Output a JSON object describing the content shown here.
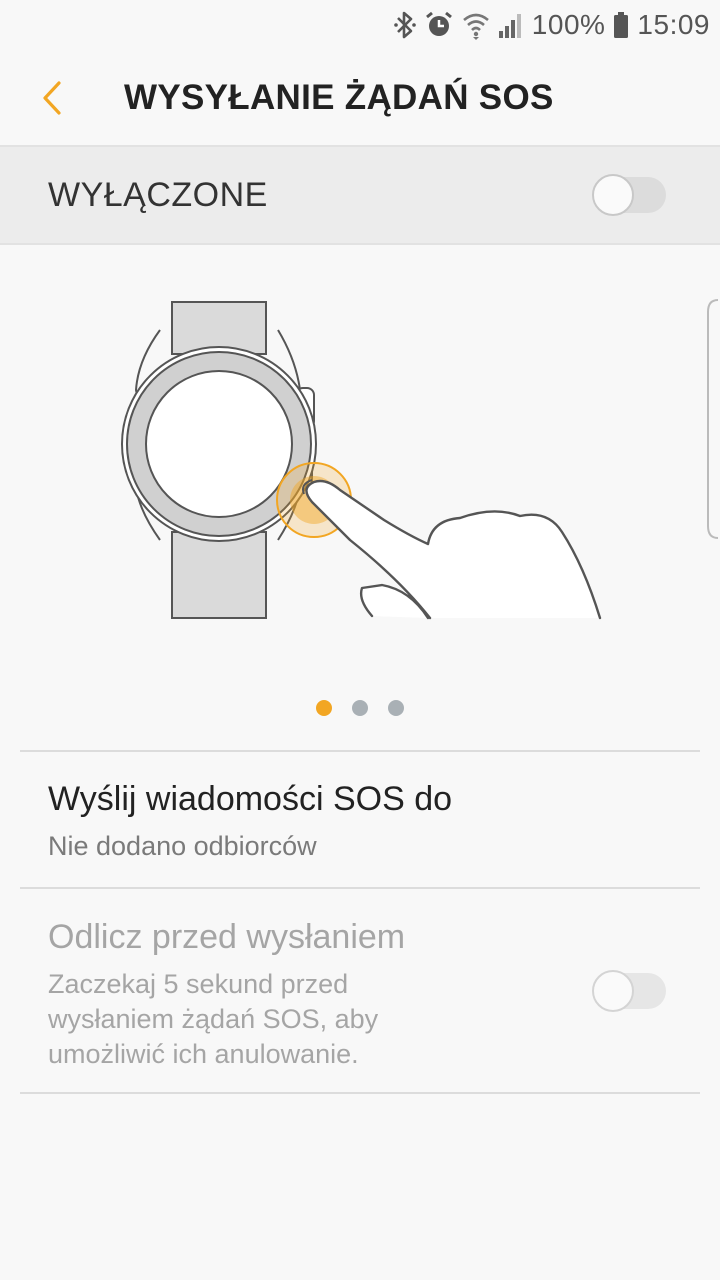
{
  "status_bar": {
    "battery": "100%",
    "time": "15:09",
    "icons": [
      "bluetooth-icon",
      "alarm-icon",
      "wifi-icon",
      "signal-icon",
      "battery-icon"
    ]
  },
  "header": {
    "title": "WYSYŁANIE ŻĄDAŃ SOS",
    "back_icon": "chevron-left-icon",
    "accent": "#f2a623"
  },
  "master_switch": {
    "label": "WYŁĄCZONE",
    "state": "off"
  },
  "carousel": {
    "pages": 3,
    "active_page": 1,
    "illustration": "watch-button-press"
  },
  "settings": [
    {
      "title": "Wyślij wiadomości SOS do",
      "subtitle": "Nie dodano odbiorców"
    },
    {
      "title": "Odlicz przed wysłaniem",
      "subtitle_lines": [
        "Zaczekaj 5 sekund przed",
        "wysłaniem żądań SOS, aby",
        "umożliwić ich anulowanie."
      ],
      "toggle": "off",
      "enabled": false
    }
  ]
}
